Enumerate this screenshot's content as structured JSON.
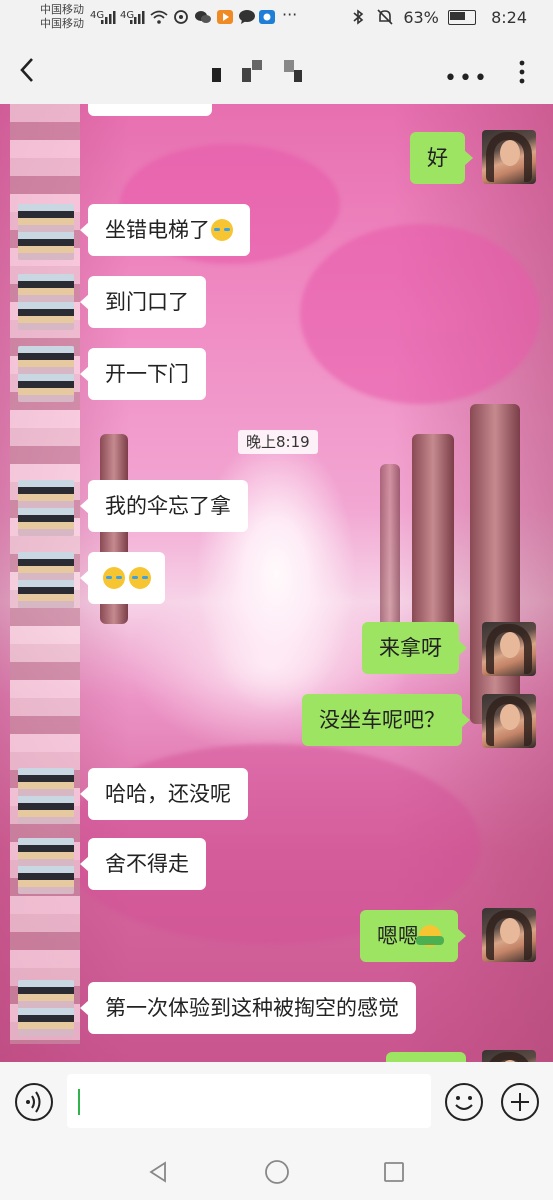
{
  "status_bar": {
    "carrier_1": "中国移动",
    "carrier_2": "中国移动",
    "signal_1": "4G",
    "signal_2": "4G",
    "battery_percent": "63%",
    "time": "8:24"
  },
  "header": {
    "title_mosaic": "",
    "more_label": "•••"
  },
  "messages": [
    {
      "side": "out",
      "text": "好"
    },
    {
      "side": "in",
      "text": "坐错电梯了",
      "emoji": "😭"
    },
    {
      "side": "in",
      "text": "到门口了"
    },
    {
      "side": "in",
      "text": "开一下门"
    },
    {
      "side": "system",
      "text": "晚上8:19"
    },
    {
      "side": "in",
      "text": "我的伞忘了拿"
    },
    {
      "side": "in",
      "text": "",
      "emoji": "😂😂"
    },
    {
      "side": "out",
      "text": "来拿呀"
    },
    {
      "side": "out",
      "text": "没坐车呢吧？"
    },
    {
      "side": "in",
      "text": "哈哈，还没呢"
    },
    {
      "side": "in",
      "text": "舍不得走"
    },
    {
      "side": "out",
      "text": "嗯嗯",
      "emoji": "🤗"
    },
    {
      "side": "in",
      "text": "第一次体验到这种被掏空的感觉"
    }
  ],
  "input_bar": {
    "placeholder": ""
  },
  "colors": {
    "outgoing_bubble": "#9de463",
    "incoming_bubble": "#ffffff",
    "caret": "#2fb34a"
  }
}
